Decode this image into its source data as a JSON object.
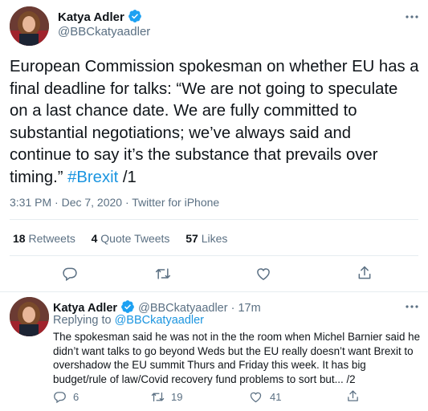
{
  "main_tweet": {
    "author_name": "Katya Adler",
    "author_handle": "@BBCkatyaadler",
    "text_lines": [
      "European Commission spokesman on whether EU has a",
      "final deadline for talks: “We are not going to speculate",
      "on a last chance date. We are fully committed to",
      "substantial negotiations; we’ve always said and",
      "continue to say it’s the substance that prevails over"
    ],
    "last_line_prefix": "timing.” ",
    "hashtag": "#Brexit",
    "last_line_suffix": " /1",
    "timestamp": "3:31 PM · Dec 7, 2020 · Twitter for iPhone",
    "stats": {
      "retweets_count": "18",
      "retweets_label": "Retweets",
      "quote_count": "4",
      "quote_label": "Quote Tweets",
      "likes_count": "57",
      "likes_label": "Likes"
    }
  },
  "reply_tweet": {
    "author_name": "Katya Adler",
    "author_handle": "@BBCkatyaadler",
    "separator": "·",
    "time": "17m",
    "replying_prefix": "Replying to ",
    "replying_handle": "@BBCkatyaadler",
    "text_lines": [
      "The spokesman said he was not in the the room when Michel Barnier said he",
      "didn’t want talks to go beyond Weds but the EU really doesn’t want Brexit to",
      "overshadow the EU summit Thurs and Friday this week. It has big",
      "budget/rule of law/Covid recovery fund problems to sort but... /2"
    ],
    "reply_count": "6",
    "retweet_count": "19",
    "like_count": "41"
  },
  "icons": {
    "verified": "verified-badge-icon",
    "more": "more-dots-icon",
    "reply": "comment-icon",
    "retweet": "retweet-icon",
    "like": "heart-icon",
    "share": "share-icon"
  },
  "colors": {
    "accent": "#1b95e0",
    "text": "#0f1419",
    "muted": "#5b7083",
    "divider": "#e6ecf0"
  }
}
